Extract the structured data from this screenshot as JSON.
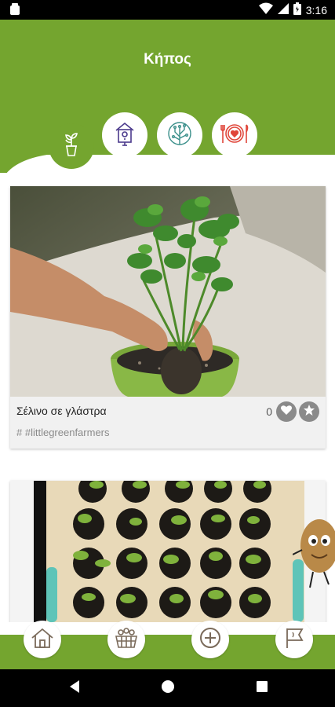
{
  "status_bar": {
    "time": "3:16"
  },
  "header": {
    "title": "Κήπος"
  },
  "category_tabs": [
    {
      "icon": "potted-plant-icon",
      "active": true
    },
    {
      "icon": "birdhouse-icon",
      "active": false
    },
    {
      "icon": "circuit-tree-icon",
      "active": false
    },
    {
      "icon": "plate-heart-icon",
      "active": false
    }
  ],
  "posts": [
    {
      "title": "Σέλινο σε γλάστρα",
      "tag": "# #littlegreenfarmers",
      "likes": "0"
    }
  ],
  "bottom_nav": [
    {
      "icon": "home-icon"
    },
    {
      "icon": "basket-icon"
    },
    {
      "icon": "add-icon"
    },
    {
      "icon": "flag-icon"
    }
  ],
  "colors": {
    "brand_green": "#74a52f",
    "icon_purple": "#4b3a8c",
    "icon_teal": "#3a8f8a",
    "icon_red": "#e0463a"
  }
}
